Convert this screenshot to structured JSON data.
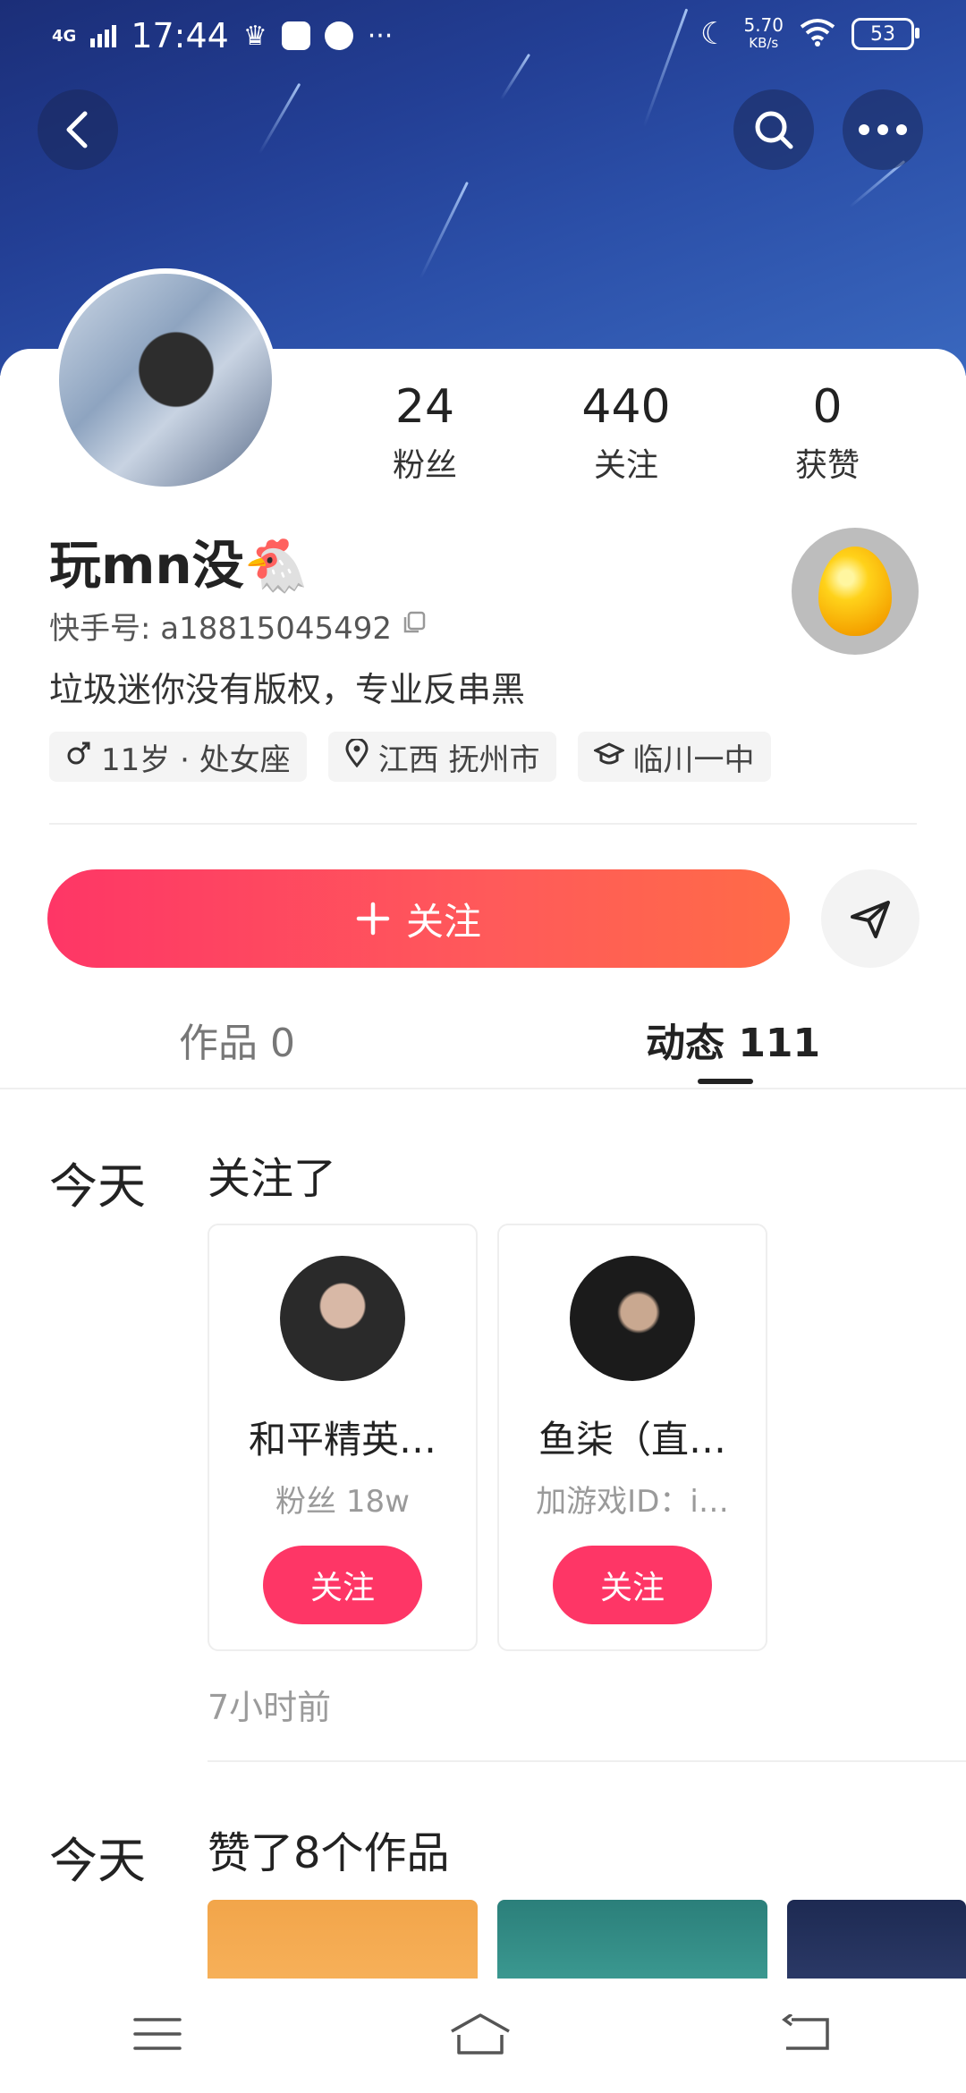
{
  "status_bar": {
    "network": "4G",
    "time": "17:44",
    "net_speed_value": "5.70",
    "net_speed_unit": "KB/s",
    "battery": "53"
  },
  "profile": {
    "stats": [
      {
        "value": "24",
        "label": "粉丝"
      },
      {
        "value": "440",
        "label": "关注"
      },
      {
        "value": "0",
        "label": "获赞"
      }
    ],
    "name": "玩mn没🐔",
    "kuaishou_id": "快手号: a18815045492",
    "bio": "垃圾迷你没有版权，专业反串黑",
    "tags": [
      "11岁 · 处女座",
      "江西 抚州市",
      "临川一中"
    ]
  },
  "actions": {
    "follow_label": "关注"
  },
  "tabs": [
    {
      "label": "作品 0"
    },
    {
      "label": "动态 111"
    }
  ],
  "feed": {
    "day1": "今天",
    "activity1": "关注了",
    "users": [
      {
        "name": "和平精英…",
        "sub": "粉丝 18w",
        "button": "关注"
      },
      {
        "name": "鱼柒（直…",
        "sub": "加游戏ID：i…",
        "button": "关注"
      }
    ],
    "time1": "7小时前",
    "day2": "今天",
    "activity2": "赞了8个作品"
  },
  "colors": {
    "accent": "#fe3666",
    "header": "#233f95"
  }
}
